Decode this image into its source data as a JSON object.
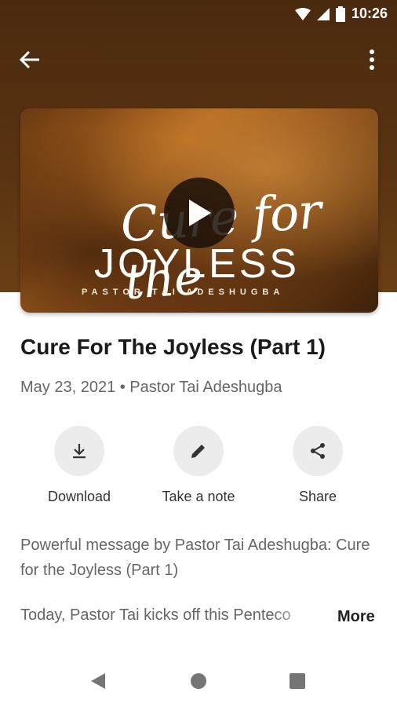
{
  "status_bar": {
    "time": "10:26"
  },
  "sermon": {
    "thumbnail_script": "Cure for the",
    "thumbnail_title": "JOYLESS",
    "thumbnail_subtitle": "PASTOR TAI ADESHUGBA",
    "title": "Cure For The Joyless (Part 1)",
    "meta": "May 23, 2021 • Pastor Tai Adeshugba"
  },
  "actions": [
    {
      "label": "Download",
      "icon": "download-icon"
    },
    {
      "label": "Take a note",
      "icon": "pencil-icon"
    },
    {
      "label": "Share",
      "icon": "share-icon"
    }
  ],
  "description": {
    "line1": "Powerful message by Pastor Tai Adeshugba: Cure for the Joyless (Part 1)",
    "teaser": "Today, Pastor Tai kicks off this Penteco",
    "more_label": "More"
  },
  "colors": {
    "hero_brown": "#5a3412",
    "action_bg": "#ececec"
  }
}
